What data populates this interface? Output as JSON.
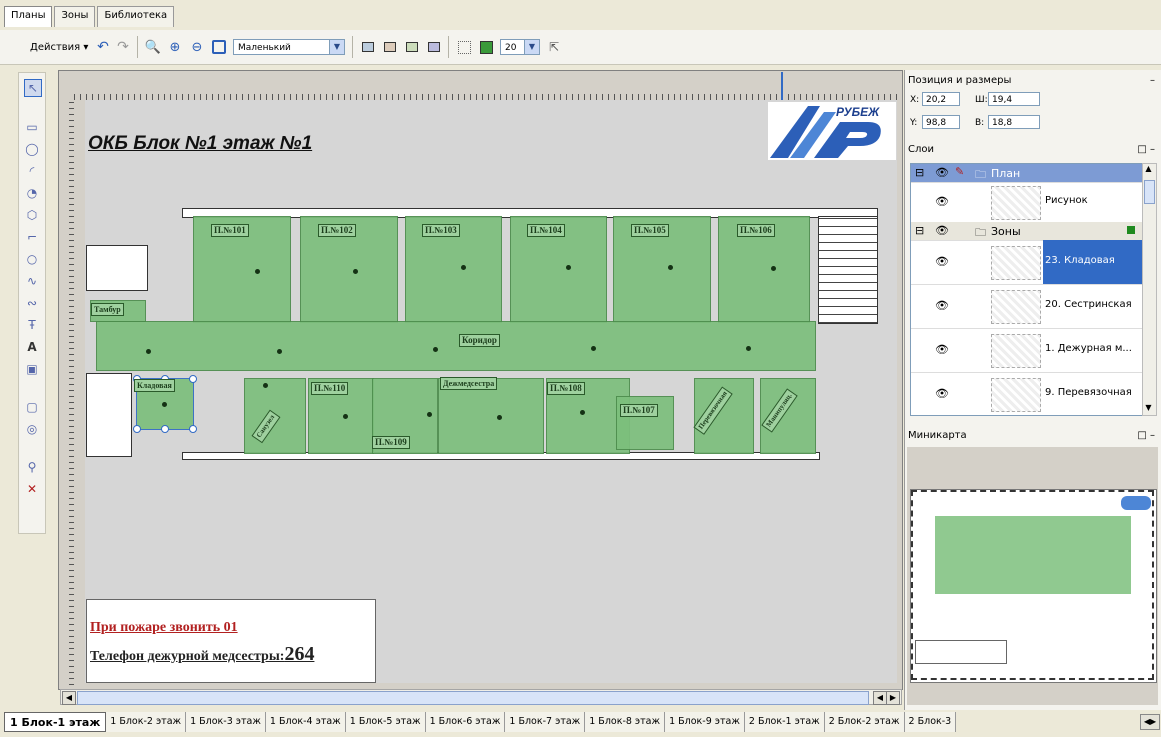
{
  "top_tabs": [
    "Планы",
    "Зоны",
    "Библиотека"
  ],
  "toolbar": {
    "actions_label": "Действия ▾",
    "size_combo": "Маленький",
    "number_combo": "20"
  },
  "plan": {
    "title": "ОКБ Блок №1 этаж №1",
    "logo_text": "РУБЕЖ",
    "fire_text": "При пожаре звонить  01",
    "phone_label": "Телефон дежурной медсестры:",
    "phone_number": "264"
  },
  "rooms": {
    "r101": "П.№101",
    "r102": "П.№102",
    "r103": "П.№103",
    "r104": "П.№104",
    "r105": "П.№105",
    "r106": "П.№106",
    "r108": "П.№108",
    "r107": "П.№107",
    "r109": "П.№109",
    "r110": "П.№110",
    "corridor": "Коридор",
    "nurse": "Дежмедсестра",
    "pantry": "Кладовая",
    "entry": "Тамбур",
    "dress": "Перевязочная",
    "proc": "Манипуляц.",
    "small1": "Санузел"
  },
  "position_panel": {
    "title": "Позиция и размеры",
    "x_label": "X:",
    "x_value": "20,2",
    "w_label": "Ш:",
    "w_value": "19,4",
    "y_label": "Y:",
    "y_value": "98,8",
    "h_label": "В:",
    "h_value": "18,8"
  },
  "layers_panel": {
    "title": "Слои",
    "group_plan": "План",
    "picture": "Рисунок",
    "group_zones": "Зоны",
    "items": [
      "23. Кладовая",
      "20. Сестринская",
      "1. Дежурная м...",
      "9. Перевязочная"
    ]
  },
  "minimap_panel": {
    "title": "Миникарта"
  },
  "bottom_tabs": [
    "1 Блок-1 этаж",
    "1 Блок-2 этаж",
    "1 Блок-3 этаж",
    "1 Блок-4 этаж",
    "1 Блок-5 этаж",
    "1 Блок-6 этаж",
    "1 Блок-7 этаж",
    "1 Блок-8 этаж",
    "1 Блок-9 этаж",
    "2 Блок-1 этаж",
    "2 Блок-2 этаж",
    "2 Блок-3"
  ],
  "colors": {
    "zone_fill": "#7cbf7c",
    "selection": "#316ac5",
    "fire_text": "#b22020"
  }
}
